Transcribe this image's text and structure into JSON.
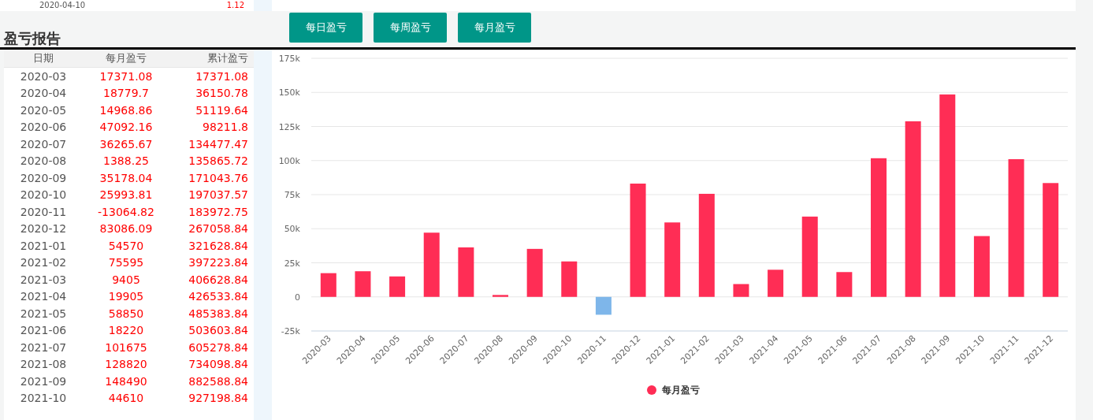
{
  "previous_table": {
    "row": [
      "2020-04-10",
      "1.12"
    ]
  },
  "buttons": [
    {
      "label": "每日盈亏"
    },
    {
      "label": "每周盈亏"
    },
    {
      "label": "每月盈亏"
    }
  ],
  "report": {
    "title": "盈亏报告",
    "columns": [
      "日期",
      "每月盈亏",
      "累计盈亏"
    ],
    "rows": [
      [
        "2020-03",
        "17371.08",
        "17371.08"
      ],
      [
        "2020-04",
        "18779.7",
        "36150.78"
      ],
      [
        "2020-05",
        "14968.86",
        "51119.64"
      ],
      [
        "2020-06",
        "47092.16",
        "98211.8"
      ],
      [
        "2020-07",
        "36265.67",
        "134477.47"
      ],
      [
        "2020-08",
        "1388.25",
        "135865.72"
      ],
      [
        "2020-09",
        "35178.04",
        "171043.76"
      ],
      [
        "2020-10",
        "25993.81",
        "197037.57"
      ],
      [
        "2020-11",
        "-13064.82",
        "183972.75"
      ],
      [
        "2020-12",
        "83086.09",
        "267058.84"
      ],
      [
        "2021-01",
        "54570",
        "321628.84"
      ],
      [
        "2021-02",
        "75595",
        "397223.84"
      ],
      [
        "2021-03",
        "9405",
        "406628.84"
      ],
      [
        "2021-04",
        "19905",
        "426533.84"
      ],
      [
        "2021-05",
        "58850",
        "485383.84"
      ],
      [
        "2021-06",
        "18220",
        "503603.84"
      ],
      [
        "2021-07",
        "101675",
        "605278.84"
      ],
      [
        "2021-08",
        "128820",
        "734098.84"
      ],
      [
        "2021-09",
        "148490",
        "882588.84"
      ],
      [
        "2021-10",
        "44610",
        "927198.84"
      ]
    ]
  },
  "chart": {
    "chart_data": {
      "type": "bar",
      "categories": [
        "2020-03",
        "2020-04",
        "2020-05",
        "2020-06",
        "2020-07",
        "2020-08",
        "2020-09",
        "2020-10",
        "2020-11",
        "2020-12",
        "2021-01",
        "2021-02",
        "2021-03",
        "2021-04",
        "2021-05",
        "2021-06",
        "2021-07",
        "2021-08",
        "2021-09",
        "2021-10",
        "2021-11",
        "2021-12"
      ],
      "grid": true,
      "stacked": true,
      "series": [
        {
          "name": "每月盈亏",
          "color": "#ff2d55",
          "values": [
            17400,
            18800,
            15000,
            47100,
            36300,
            1400,
            35200,
            26000,
            null,
            83100,
            54600,
            75600,
            9400,
            19900,
            58900,
            18200,
            101700,
            128800,
            148500,
            44600,
            101000,
            83500
          ]
        },
        {
          "color": "#7eb6ea",
          "values": [
            null,
            null,
            null,
            null,
            null,
            null,
            null,
            null,
            -13100,
            null,
            null,
            null,
            null,
            null,
            null,
            null,
            null,
            null,
            null,
            null,
            null,
            null
          ]
        }
      ],
      "ylim": [
        -25000,
        175000
      ],
      "yticks": [
        {
          "value": -25000,
          "label": "-25k"
        },
        {
          "value": 0,
          "label": "0"
        },
        {
          "value": 25000,
          "label": "25k"
        },
        {
          "value": 50000,
          "label": "50k"
        },
        {
          "value": 75000,
          "label": "75k"
        },
        {
          "value": 100000,
          "label": "100k"
        },
        {
          "value": 125000,
          "label": "125k"
        },
        {
          "value": 150000,
          "label": "150k"
        },
        {
          "value": 175000,
          "label": "175k"
        }
      ]
    }
  }
}
